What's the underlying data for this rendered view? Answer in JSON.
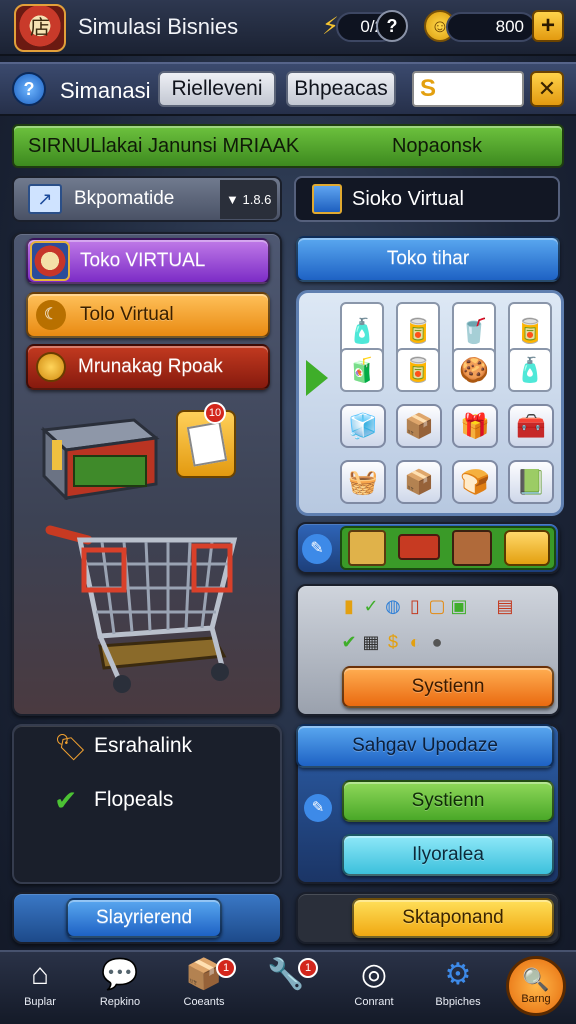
{
  "header": {
    "title": "Simulasi Bisnies",
    "logo_text": "店",
    "coins": "0/2",
    "coins_icon": "?",
    "gems": "800",
    "add_label": "+"
  },
  "subheader": {
    "menu_label": "Simanasi",
    "tab1": "Rielleveni",
    "tab2": "Bhpeacas",
    "currency_symbol": "S",
    "close_label": "✕"
  },
  "banner": {
    "left": "SIRNULlakai Janunsi MRIAAK",
    "right": "Nopaonsk"
  },
  "dropdown": {
    "label": "Bkpomatide",
    "value": "▼ 1.8.6"
  },
  "store_field": {
    "label": "Sioko Virtual"
  },
  "left_menu": {
    "btn1": "Toko VIRTUAL",
    "btn2": "Tolo Virtual",
    "btn3": "Mrunakag Rpoak",
    "note_badge": "10"
  },
  "right_top": {
    "button": "Toko tihar"
  },
  "right_system": {
    "button": "Systienn"
  },
  "status": {
    "item1": "Esrahalink",
    "item2": "Flopeals"
  },
  "upgrade": {
    "title": "Sahgav Upodaze",
    "btn_green": "Systienn",
    "btn_cyan": "Ilyoralea"
  },
  "footer_buttons": {
    "left": "Slayrierend",
    "right": "Sktaponand"
  },
  "nav": [
    {
      "label": "Buplar",
      "icon": "home-icon",
      "glyph": "⌂"
    },
    {
      "label": "Repkino",
      "icon": "chat-icon",
      "glyph": "💬"
    },
    {
      "label": "Coeants",
      "icon": "box-icon",
      "glyph": "📦",
      "badge": "1"
    },
    {
      "label": "",
      "icon": "tools-icon",
      "glyph": "🔧",
      "badge": "1"
    },
    {
      "label": "Conrant",
      "icon": "ring-icon",
      "glyph": "◎"
    },
    {
      "label": "Bbpiches",
      "icon": "gear-icon",
      "glyph": "⚙"
    },
    {
      "label": "Barng",
      "icon": "search-icon",
      "glyph": "🔍"
    }
  ],
  "colors": {
    "accent_orange": "#f08a1c",
    "accent_green": "#5cb63a",
    "accent_blue": "#2f7fd6",
    "accent_purple": "#9a3fd6"
  }
}
